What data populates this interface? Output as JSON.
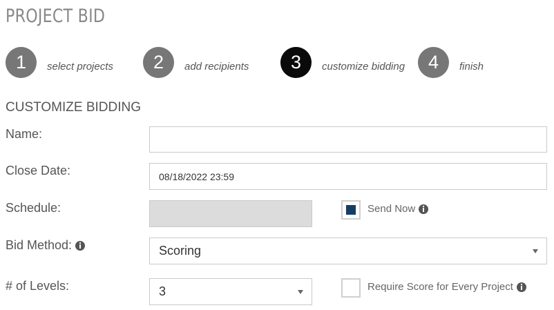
{
  "page": {
    "title": "PROJECT BID"
  },
  "steps": [
    {
      "number": "1",
      "label": "select projects",
      "active": false
    },
    {
      "number": "2",
      "label": "add recipients",
      "active": false
    },
    {
      "number": "3",
      "label": "customize bidding",
      "active": true
    },
    {
      "number": "4",
      "label": "finish",
      "active": false
    }
  ],
  "form": {
    "section_title": "CUSTOMIZE BIDDING",
    "name": {
      "label": "Name:",
      "value": ""
    },
    "close_date": {
      "label": "Close Date:",
      "value": "08/18/2022 23:59"
    },
    "schedule": {
      "label": "Schedule:",
      "value": "",
      "disabled": true
    },
    "send_now": {
      "label": "Send Now",
      "checked": true
    },
    "bid_method": {
      "label": "Bid Method:",
      "selected": "Scoring"
    },
    "levels": {
      "label": "# of Levels:",
      "selected": "3"
    },
    "require_score": {
      "label": "Require Score for Every Project",
      "checked": false
    }
  },
  "colors": {
    "step_inactive": "#777777",
    "step_active": "#0a0a0a",
    "checkbox_fill": "#163e64",
    "disabled_field": "#dcdcdc"
  },
  "icons": [
    "info-icon",
    "chevron-down-icon",
    "checkbox"
  ]
}
